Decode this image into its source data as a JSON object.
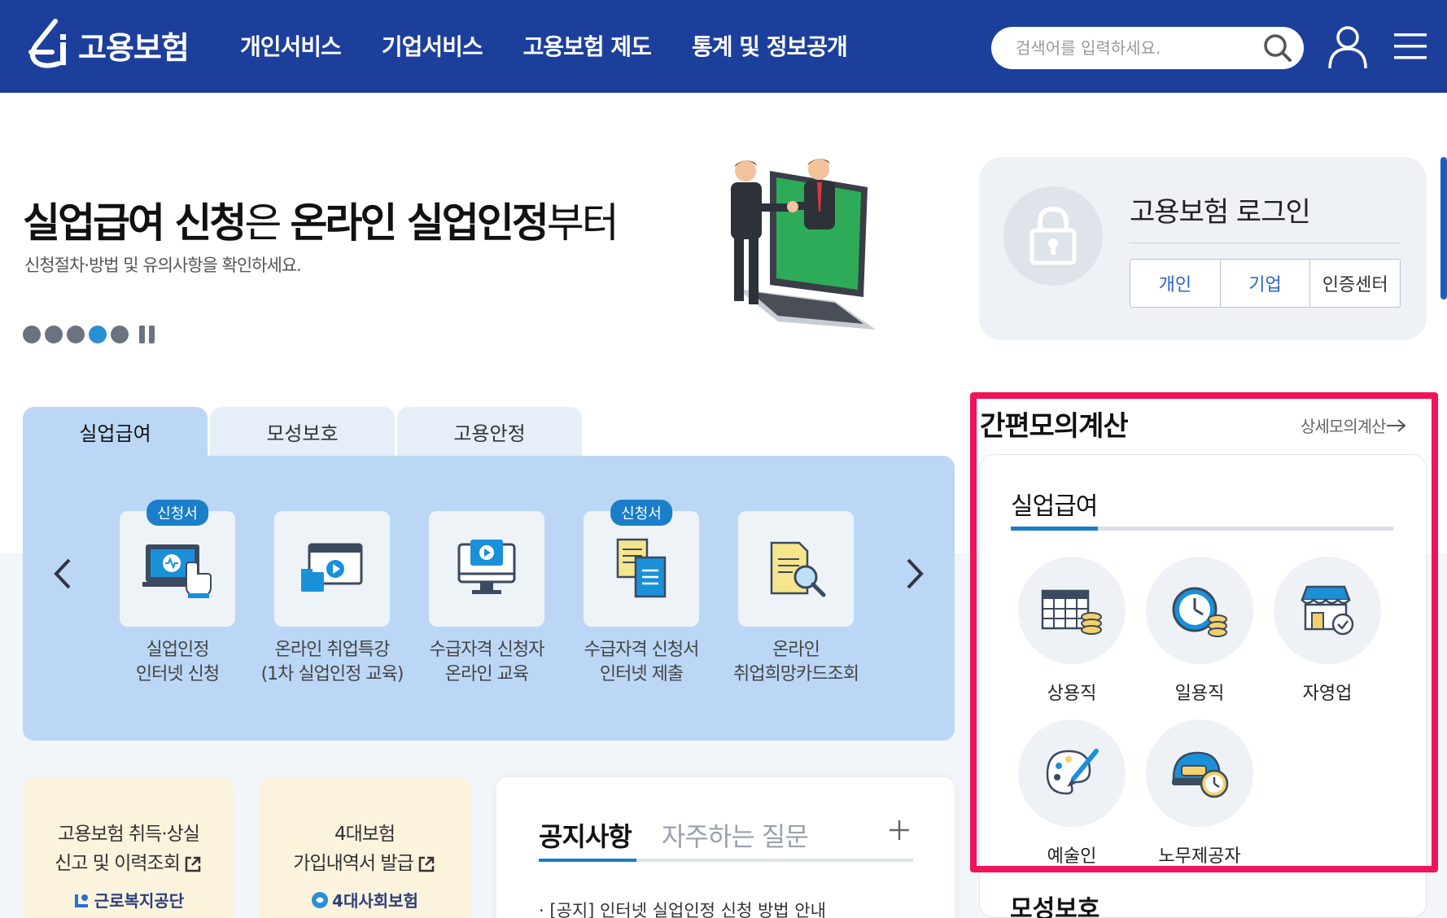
{
  "header": {
    "logo_text": "고용보험",
    "nav": [
      "개인서비스",
      "기업서비스",
      "고용보험 제도",
      "통계 및 정보공개"
    ],
    "search_placeholder": "검색어를 입력하세요."
  },
  "hero": {
    "title_bold1": "실업급여 신청",
    "title_light1": "은 ",
    "title_bold2": "온라인 실업인정",
    "title_light2": "부터",
    "subtitle": "신청절차·방법 및 유의사항을 확인하세요.",
    "slide_count": 5,
    "active_slide": 4
  },
  "login": {
    "title": "고용보험 로그인",
    "buttons": [
      "개인",
      "기업",
      "인증센터"
    ]
  },
  "tabs": [
    "실업급여",
    "모성보호",
    "고용안정"
  ],
  "services": [
    {
      "badge": "신청서",
      "line1": "실업인정",
      "line2": "인터넷 신청"
    },
    {
      "badge": "",
      "line1": "온라인 취업특강",
      "line2": "(1차 실업인정 교육)"
    },
    {
      "badge": "",
      "line1": "수급자격 신청자",
      "line2": "온라인 교육"
    },
    {
      "badge": "신청서",
      "line1": "수급자격 신청서",
      "line2": "인터넷 제출"
    },
    {
      "badge": "",
      "line1": "온라인",
      "line2": "취업희망카드조회"
    }
  ],
  "cards": {
    "card1_line1": "고용보험 취득·상실",
    "card1_line2": "신고 및 이력조회",
    "card1_logo": "근로복지공단",
    "card2_line1": "4대보험",
    "card2_line2": "가입내역서 발급",
    "card2_logo": "4대사회보험"
  },
  "notice": {
    "tab1": "공지사항",
    "tab2": "자주하는 질문",
    "item1": "· [공지] 인터넷 실업인정 신청 방법 안내"
  },
  "calc": {
    "title": "간편모의계산",
    "link": "상세모의계산",
    "sub": "실업급여",
    "items": [
      "상용직",
      "일용직",
      "자영업",
      "예술인",
      "노무제공자"
    ],
    "next_section": "모성보호"
  },
  "colors": {
    "header_bg": "#1d3f9c",
    "accent": "#1a7ec8",
    "highlight": "#f0135a",
    "tab_panel": "#bcd7f5"
  }
}
